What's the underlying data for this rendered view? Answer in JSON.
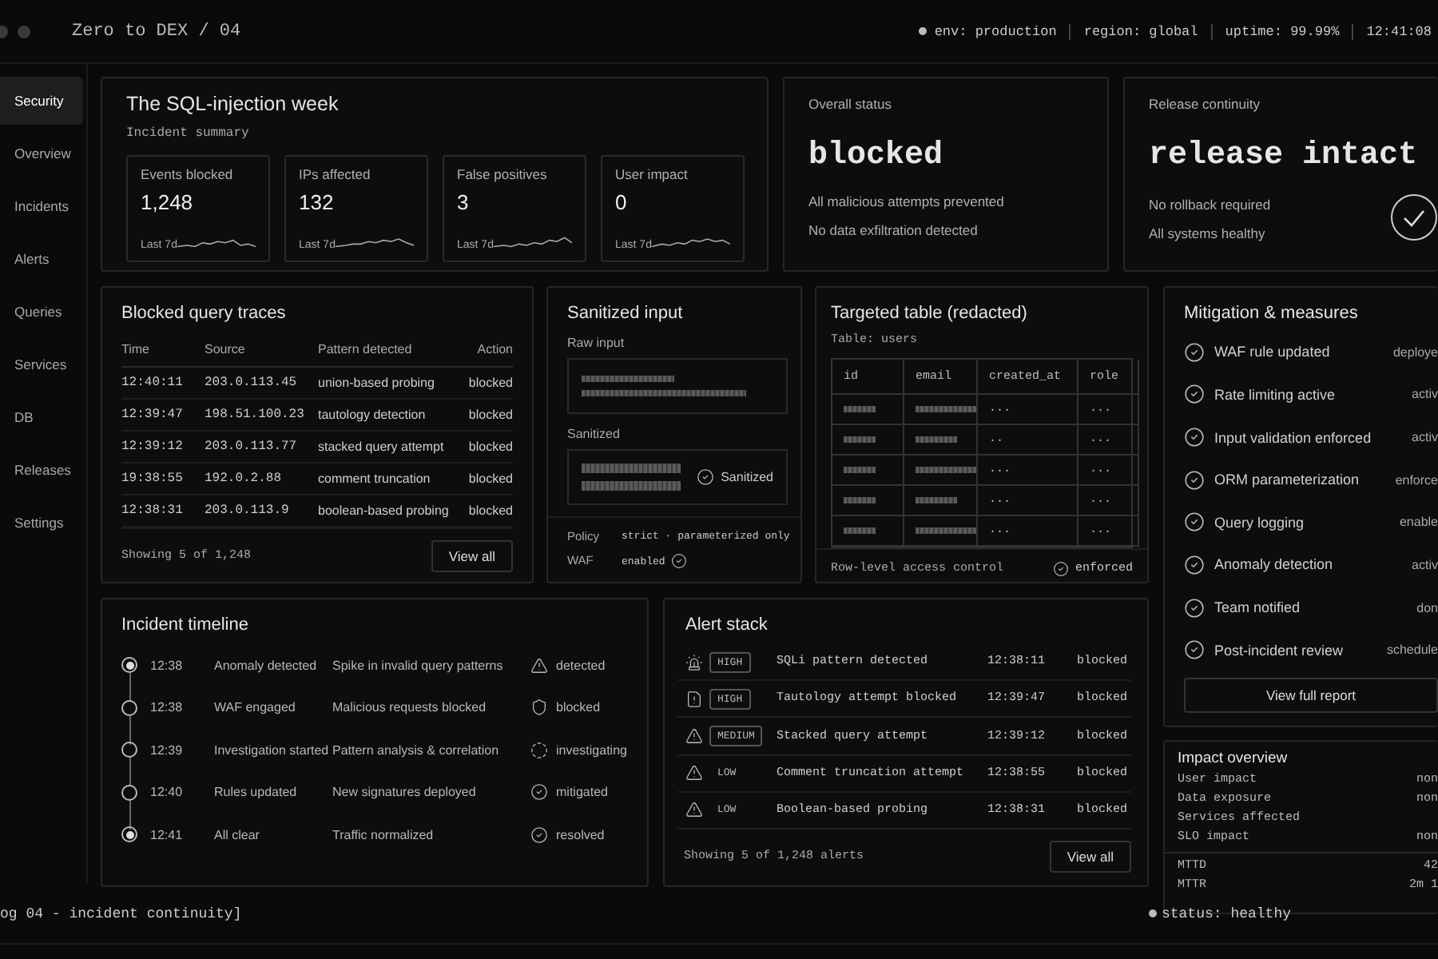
{
  "app": {
    "title": "Zero to DEX / 04",
    "status_items": [
      "env: production",
      "region: global",
      "uptime: 99.99%",
      "12:41:08"
    ]
  },
  "sidebar": {
    "items": [
      {
        "label": "Security",
        "selected": true
      },
      {
        "label": "Overview",
        "selected": false
      },
      {
        "label": "Incidents",
        "selected": false
      },
      {
        "label": "Alerts",
        "selected": false
      },
      {
        "label": "Queries",
        "selected": false
      },
      {
        "label": "Services",
        "selected": false
      },
      {
        "label": "DB",
        "selected": false
      },
      {
        "label": "Releases",
        "selected": false
      },
      {
        "label": "Settings",
        "selected": false
      }
    ]
  },
  "summary": {
    "title": "The SQL-injection week",
    "subtitle": "Incident summary",
    "stats": [
      {
        "label": "Events blocked",
        "value": "1,248",
        "period": "Last 7d"
      },
      {
        "label": "IPs affected",
        "value": "132",
        "period": "Last 7d"
      },
      {
        "label": "False positives",
        "value": "3",
        "period": "Last 7d"
      },
      {
        "label": "User impact",
        "value": "0",
        "period": "Last 7d"
      }
    ]
  },
  "overall_status": {
    "title": "Overall status",
    "value": "blocked",
    "notes": [
      "All malicious attempts prevented",
      "No data exfiltration detected"
    ]
  },
  "release_continuity": {
    "title": "Release continuity",
    "value": "release intact",
    "notes": [
      "No rollback required",
      "All systems healthy"
    ]
  },
  "traces": {
    "title": "Blocked query traces",
    "columns": [
      "Time",
      "Source",
      "Pattern detected",
      "Action"
    ],
    "rows": [
      [
        "12:40:11",
        "203.0.113.45",
        "union-based probing",
        "blocked"
      ],
      [
        "12:39:47",
        "198.51.100.23",
        "tautology detection",
        "blocked"
      ],
      [
        "12:39:12",
        "203.0.113.77",
        "stacked query attempt",
        "blocked"
      ],
      [
        "19:38:55",
        "192.0.2.88",
        "comment truncation",
        "blocked"
      ],
      [
        "12:38:31",
        "203.0.113.9",
        "boolean-based probing",
        "blocked"
      ]
    ],
    "footer": "Showing 5 of 1,248",
    "button": "View all"
  },
  "sanitized_input": {
    "title": "Sanitized input",
    "raw_label": "Raw input",
    "sanitized_label": "Sanitized",
    "sanitized_badge": "Sanitized",
    "policy": [
      {
        "label": "Policy",
        "value": "strict · parameterized only",
        "checked": false
      },
      {
        "label": "WAF",
        "value": "enabled",
        "checked": true
      }
    ]
  },
  "targeted_table": {
    "title": "Targeted table (redacted)",
    "table_name": "Table: users",
    "columns": [
      "id",
      "email",
      "created_at",
      "role"
    ],
    "rows": [
      {
        "created_at": "...",
        "role": "..."
      },
      {
        "created_at": "..",
        "role": "..."
      },
      {
        "created_at": "...",
        "role": "..."
      },
      {
        "created_at": "...",
        "role": "..."
      },
      {
        "created_at": "...",
        "role": "..."
      }
    ],
    "footer": "Row-level access control",
    "status": "enforced"
  },
  "mitigation": {
    "title": "Mitigation & measures",
    "items": [
      {
        "label": "WAF rule updated",
        "status": "deploye"
      },
      {
        "label": "Rate limiting active",
        "status": "activ"
      },
      {
        "label": "Input validation enforced",
        "status": "activ"
      },
      {
        "label": "ORM parameterization",
        "status": "enforce"
      },
      {
        "label": "Query logging",
        "status": "enable"
      },
      {
        "label": "Anomaly detection",
        "status": "activ"
      },
      {
        "label": "Team notified",
        "status": "don"
      },
      {
        "label": "Post-incident review",
        "status": "schedule"
      }
    ],
    "button": "View full report"
  },
  "timeline": {
    "title": "Incident timeline",
    "events": [
      {
        "time": "12:38",
        "event": "Anomaly detected",
        "detail": "Spike in invalid query patterns",
        "status": "detected",
        "kind": "warning",
        "highlighted": true
      },
      {
        "time": "12:38",
        "event": "WAF engaged",
        "detail": "Malicious requests blocked",
        "status": "blocked",
        "kind": "shield",
        "highlighted": false
      },
      {
        "time": "12:39",
        "event": "Investigation started",
        "detail": "Pattern analysis & correlation",
        "status": "investigating",
        "kind": "pending",
        "highlighted": false
      },
      {
        "time": "12:40",
        "event": "Rules updated",
        "detail": "New signatures deployed",
        "status": "mitigated",
        "kind": "done",
        "highlighted": false
      },
      {
        "time": "12:41",
        "event": "All clear",
        "detail": "Traffic normalized",
        "status": "resolved",
        "kind": "done",
        "highlighted": true
      }
    ]
  },
  "alerts": {
    "title": "Alert stack",
    "items": [
      {
        "severity": "HIGH",
        "boxed": true,
        "kind": "siren",
        "message": "SQLi pattern detected",
        "time": "12:38:11",
        "action": "blocked"
      },
      {
        "severity": "HIGH",
        "boxed": true,
        "kind": "report",
        "message": "Tautology attempt blocked",
        "time": "12:39:47",
        "action": "blocked"
      },
      {
        "severity": "MEDIUM",
        "boxed": true,
        "kind": "warning",
        "message": "Stacked query attempt",
        "time": "12:39:12",
        "action": "blocked"
      },
      {
        "severity": "LOW",
        "boxed": false,
        "kind": "warning",
        "message": "Comment truncation attempt",
        "time": "12:38:55",
        "action": "blocked"
      },
      {
        "severity": "LOW",
        "boxed": false,
        "kind": "warning",
        "message": "Boolean-based probing",
        "time": "12:38:31",
        "action": "blocked"
      }
    ],
    "footer": "Showing 5 of 1,248 alerts",
    "button": "View all"
  },
  "impact": {
    "title": "Impact overview",
    "rows": [
      {
        "label": "User impact",
        "value": "non"
      },
      {
        "label": "Data exposure",
        "value": "non"
      },
      {
        "label": "Services affected"
      },
      {
        "label": "SLO impact",
        "value": "non"
      }
    ],
    "times": [
      {
        "label": "MTTD",
        "value": "42"
      },
      {
        "label": "MTTR",
        "value": "2m 1"
      }
    ]
  },
  "footer": {
    "log": "og 04 - incident continuity]",
    "status": "status: healthy"
  }
}
